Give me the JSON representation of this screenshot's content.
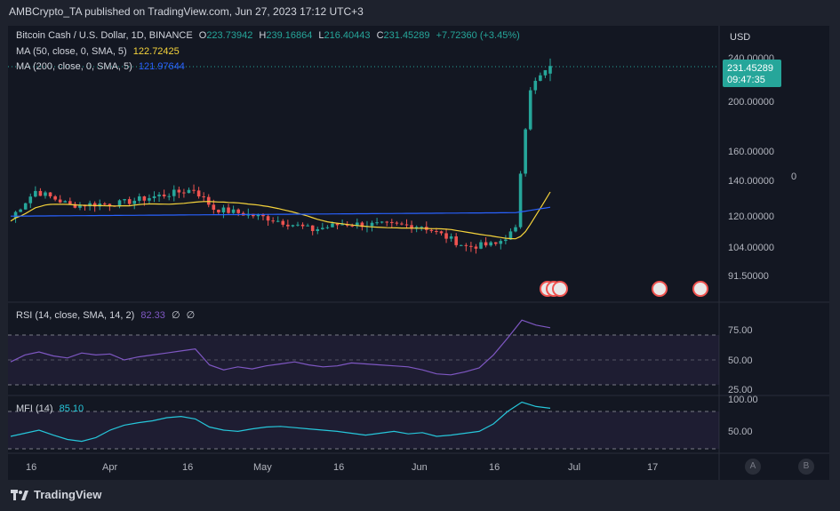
{
  "header": {
    "publisher": "AMBCrypto_TA published on TradingView.com, Jun 27, 2023 17:12 UTC+3"
  },
  "legend": {
    "symbol": "Bitcoin Cash / U.S. Dollar, 1D, BINANCE",
    "o_label": "O",
    "o": "223.73942",
    "h_label": "H",
    "h": "239.16864",
    "l_label": "L",
    "l": "216.40443",
    "c_label": "C",
    "c": "231.45289",
    "change": "+7.72360 (+3.45%)",
    "ma50_label": "MA (50, close, 0, SMA, 5)",
    "ma50_value": "122.72425",
    "ma200_label": "MA (200, close, 0, SMA, 5)",
    "ma200_value": "121.97644",
    "rsi_label": "RSI (14, close, SMA, 14, 2)",
    "rsi_value": "82.33",
    "rsi_extra1": "∅",
    "rsi_extra2": "∅",
    "mfi_label": "MFI (14)",
    "mfi_value": "85.10"
  },
  "price_axis": {
    "currency": "USD",
    "ticks": [
      "240.00000",
      "200.00000",
      "160.00000",
      "140.00000",
      "120.00000",
      "104.00000",
      "91.50000"
    ],
    "last_price": "231.45289",
    "countdown": "09:47:35",
    "side_value": "0"
  },
  "rsi_axis": {
    "ticks": [
      "75.00",
      "50.00",
      "25.00"
    ]
  },
  "mfi_axis": {
    "ticks": [
      "100.00",
      "50.00"
    ]
  },
  "time_axis": {
    "ticks": [
      "16",
      "Apr",
      "16",
      "May",
      "16",
      "Jun",
      "16",
      "Jul",
      "17"
    ]
  },
  "scale_buttons": {
    "auto": "A",
    "log": "B"
  },
  "footer": {
    "brand": "TradingView"
  },
  "colors": {
    "background": "#131722",
    "up": "#26a69a",
    "down": "#ef5350",
    "ma50": "#f5d33b",
    "ma200": "#2962ff",
    "rsi": "#7e57c2",
    "mfi": "#26c6da"
  },
  "chart_data": [
    {
      "type": "candlestick",
      "title": "Bitcoin Cash / U.S. Dollar, 1D, BINANCE",
      "ylabel": "USD",
      "x_range": [
        "2023-03-10",
        "2023-06-27"
      ],
      "ylim": [
        85,
        245
      ],
      "y_scale": "log",
      "x_ticks": [
        "16",
        "Apr",
        "16",
        "May",
        "16",
        "Jun",
        "16",
        "Jul",
        "17"
      ],
      "y_ticks": [
        240,
        200,
        160,
        140,
        120,
        104,
        91.5
      ],
      "key_points": [
        {
          "date": "2023-03-10",
          "close": 118
        },
        {
          "date": "2023-03-15",
          "close": 133
        },
        {
          "date": "2023-03-22",
          "close": 125
        },
        {
          "date": "2023-04-01",
          "close": 126
        },
        {
          "date": "2023-04-16",
          "close": 134
        },
        {
          "date": "2023-04-20",
          "close": 123
        },
        {
          "date": "2023-05-01",
          "close": 118
        },
        {
          "date": "2023-05-10",
          "close": 112
        },
        {
          "date": "2023-05-16",
          "close": 115
        },
        {
          "date": "2023-06-01",
          "close": 114
        },
        {
          "date": "2023-06-10",
          "close": 104
        },
        {
          "date": "2023-06-16",
          "close": 105
        },
        {
          "date": "2023-06-20",
          "close": 112
        },
        {
          "date": "2023-06-23",
          "close": 210
        },
        {
          "date": "2023-06-27",
          "close": 231.45
        }
      ],
      "last_candle": {
        "open": 223.73942,
        "high": 239.16864,
        "low": 216.40443,
        "close": 231.45289
      },
      "series": [
        {
          "name": "MA (50, close, 0, SMA, 5)",
          "last": 122.72425
        },
        {
          "name": "MA (200, close, 0, SMA, 5)",
          "last": 121.97644
        }
      ]
    },
    {
      "type": "line",
      "title": "RSI (14, close, SMA, 14, 2)",
      "ylim": [
        20,
        100
      ],
      "y_ticks": [
        75,
        50,
        25
      ],
      "band": [
        30,
        70
      ],
      "series": [
        {
          "name": "RSI",
          "values": [
            48,
            55,
            58,
            54,
            52,
            57,
            55,
            56,
            50,
            53,
            55,
            57,
            59,
            61,
            45,
            40,
            43,
            41,
            44,
            46,
            48,
            45,
            43,
            44,
            47,
            46,
            45,
            44,
            43,
            40,
            36,
            35,
            38,
            42,
            55,
            72,
            90,
            85,
            82.33
          ]
        }
      ]
    },
    {
      "type": "line",
      "title": "MFI (14)",
      "ylim": [
        20,
        100
      ],
      "y_ticks": [
        100,
        50
      ],
      "band": [
        20,
        80
      ],
      "series": [
        {
          "name": "MFI",
          "values": [
            40,
            45,
            50,
            42,
            35,
            32,
            38,
            50,
            58,
            62,
            65,
            70,
            72,
            68,
            55,
            50,
            48,
            52,
            55,
            56,
            54,
            52,
            50,
            48,
            45,
            42,
            45,
            48,
            44,
            46,
            40,
            42,
            45,
            48,
            60,
            80,
            95,
            88,
            85.1
          ]
        }
      ]
    }
  ]
}
